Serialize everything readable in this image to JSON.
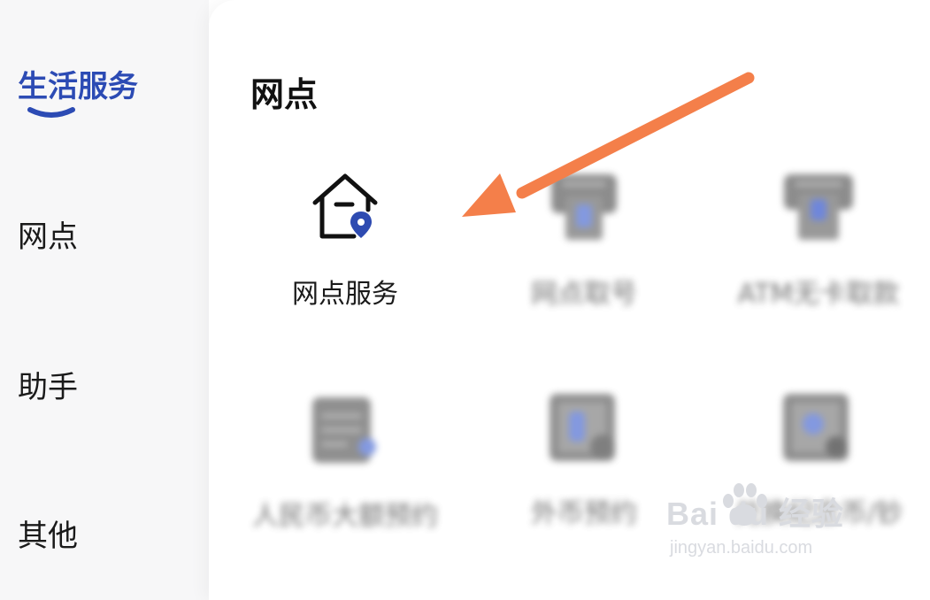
{
  "sidebar": {
    "items": [
      {
        "label": "生活服务",
        "active": true
      },
      {
        "label": "网点"
      },
      {
        "label": "助手"
      },
      {
        "label": "其他"
      }
    ]
  },
  "main": {
    "section_title": "网点",
    "tiles": [
      {
        "label": "网点服务",
        "icon": "house-location-icon"
      },
      {
        "label": "网点取号",
        "icon": "ticket-machine-icon",
        "blurred": true
      },
      {
        "label": "ATM无卡取款",
        "icon": "atm-icon",
        "blurred": true
      },
      {
        "label": "人民币大额预约",
        "icon": "calendar-icon",
        "blurred": true
      },
      {
        "label": "外币预约",
        "icon": "currency-icon",
        "blurred": true
      },
      {
        "label": "兑换纪念币/钞",
        "icon": "coin-exchange-icon",
        "blurred": true
      }
    ]
  },
  "annotation": {
    "color": "#f47f4a"
  },
  "watermark": {
    "logo": "Bai du 经验",
    "url": "jingyan.baidu.com"
  },
  "colors": {
    "accent": "#2c4bb4",
    "pin": "#2e4bb1"
  }
}
